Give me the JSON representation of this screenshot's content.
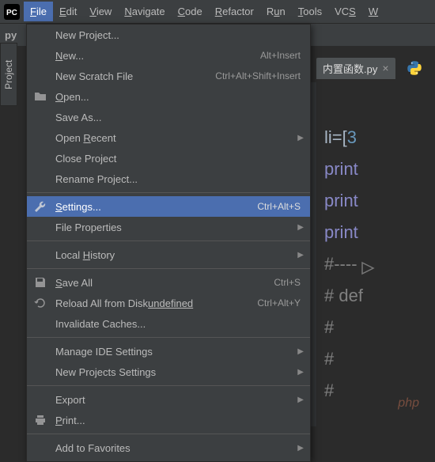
{
  "menubar": {
    "items": [
      {
        "label": "File",
        "u": 0,
        "active": true
      },
      {
        "label": "Edit",
        "u": 0
      },
      {
        "label": "View",
        "u": 0
      },
      {
        "label": "Navigate",
        "u": 0
      },
      {
        "label": "Code",
        "u": 0
      },
      {
        "label": "Refactor",
        "u": 0
      },
      {
        "label": "Run",
        "u": 1
      },
      {
        "label": "Tools",
        "u": 0
      },
      {
        "label": "VCS",
        "u": 2
      },
      {
        "label": "W",
        "u": 0
      }
    ]
  },
  "sidetab": {
    "label": "Project"
  },
  "crumb": {
    "label": "py"
  },
  "tab": {
    "label": "内置函数.py"
  },
  "dropdown": {
    "groups": [
      [
        {
          "label": "New Project...",
          "icon": ""
        },
        {
          "label": "New...",
          "u": 0,
          "shortcut": "Alt+Insert"
        },
        {
          "label": "New Scratch File",
          "shortcut": "Ctrl+Alt+Shift+Insert"
        },
        {
          "label": "Open...",
          "u": 0,
          "icon": "folder"
        },
        {
          "label": "Save As..."
        },
        {
          "label": "Open Recent",
          "u": 5,
          "submenu": true
        },
        {
          "label": "Close Project"
        },
        {
          "label": "Rename Project..."
        }
      ],
      [
        {
          "label": "Settings...",
          "u": 0,
          "shortcut": "Ctrl+Alt+S",
          "icon": "wrench",
          "active": true
        },
        {
          "label": "File Properties",
          "submenu": true
        }
      ],
      [
        {
          "label": "Local History",
          "u": 6,
          "submenu": true
        }
      ],
      [
        {
          "label": "Save All",
          "u": 0,
          "shortcut": "Ctrl+S",
          "icon": "save"
        },
        {
          "label": "Reload All from Disk",
          "u": 22,
          "shortcut": "Ctrl+Alt+Y",
          "icon": "reload"
        },
        {
          "label": "Invalidate Caches..."
        }
      ],
      [
        {
          "label": "Manage IDE Settings",
          "submenu": true
        },
        {
          "label": "New Projects Settings",
          "submenu": true
        }
      ],
      [
        {
          "label": "Export",
          "submenu": true
        },
        {
          "label": "Print...",
          "u": 0,
          "icon": "print"
        }
      ],
      [
        {
          "label": "Add to Favorites",
          "submenu": true
        }
      ]
    ]
  },
  "editor": {
    "lines": [
      {
        "text": ""
      },
      {
        "text": "li=[3",
        "cls": "plain"
      },
      {
        "text": "print",
        "cls": "fn"
      },
      {
        "text": "print",
        "cls": "fn"
      },
      {
        "text": "print",
        "cls": "fn"
      },
      {
        "text": "#----",
        "cls": "cm"
      },
      {
        "text": "# def",
        "cls": "cm"
      },
      {
        "text": "#",
        "cls": "cm"
      },
      {
        "text": "#",
        "cls": "cm"
      },
      {
        "text": "#",
        "cls": "cm"
      }
    ]
  },
  "watermark": "php"
}
